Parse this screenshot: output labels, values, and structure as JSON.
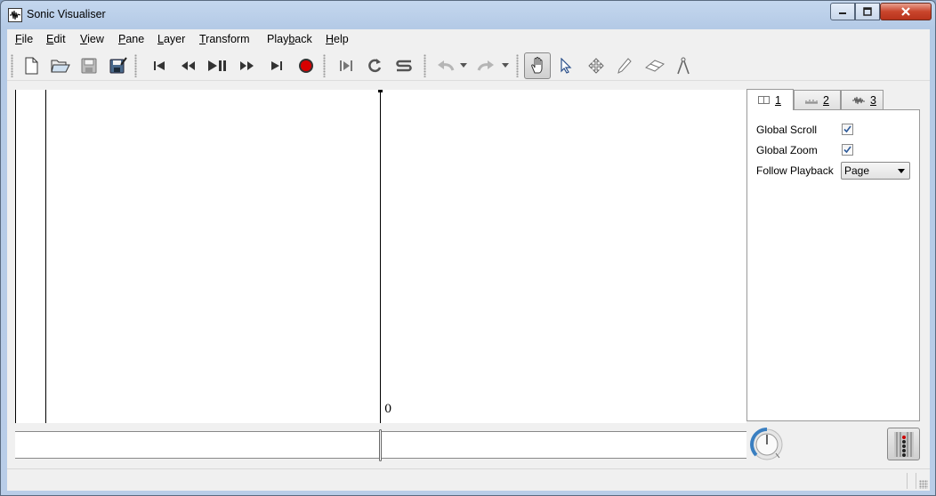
{
  "window": {
    "title": "Sonic Visualiser"
  },
  "menu": {
    "items": [
      {
        "pre": "",
        "key": "F",
        "post": "ile"
      },
      {
        "pre": "",
        "key": "E",
        "post": "dit"
      },
      {
        "pre": "",
        "key": "V",
        "post": "iew"
      },
      {
        "pre": "",
        "key": "P",
        "post": "ane"
      },
      {
        "pre": "",
        "key": "L",
        "post": "ayer"
      },
      {
        "pre": "",
        "key": "T",
        "post": "ransform"
      },
      {
        "pre": "Play",
        "key": "b",
        "post": "ack"
      },
      {
        "pre": "",
        "key": "H",
        "post": "elp"
      }
    ]
  },
  "toolbar": {
    "icons": [
      "new-session-icon",
      "open-icon",
      "save-icon",
      "save-as-icon",
      "rewind-start-icon",
      "rewind-icon",
      "play-pause-icon",
      "fast-forward-icon",
      "fast-forward-end-icon",
      "record-icon",
      "play-selection-icon",
      "loop-icon",
      "solo-icon",
      "undo-icon",
      "undo-menu-icon",
      "redo-icon",
      "redo-menu-icon",
      "navigate-tool-icon",
      "select-tool-icon",
      "move-tool-icon",
      "draw-tool-icon",
      "erase-tool-icon",
      "measure-tool-icon"
    ],
    "active_tool": "navigate-tool-icon"
  },
  "pane": {
    "center_label": "0"
  },
  "property_tabs": {
    "tabs": [
      {
        "label": "1",
        "icon": "pane-icon",
        "selected": true
      },
      {
        "label": "2",
        "icon": "ruler-icon",
        "selected": false
      },
      {
        "label": "3",
        "icon": "waveform-icon",
        "selected": false
      }
    ]
  },
  "properties": {
    "global_scroll": {
      "label": "Global Scroll",
      "checked": true
    },
    "global_zoom": {
      "label": "Global Zoom",
      "checked": true
    },
    "follow_playback": {
      "label": "Follow Playback",
      "value": "Page"
    }
  },
  "colors": {
    "record_red": "#d80000",
    "dial_blue": "#3a7fc1"
  }
}
